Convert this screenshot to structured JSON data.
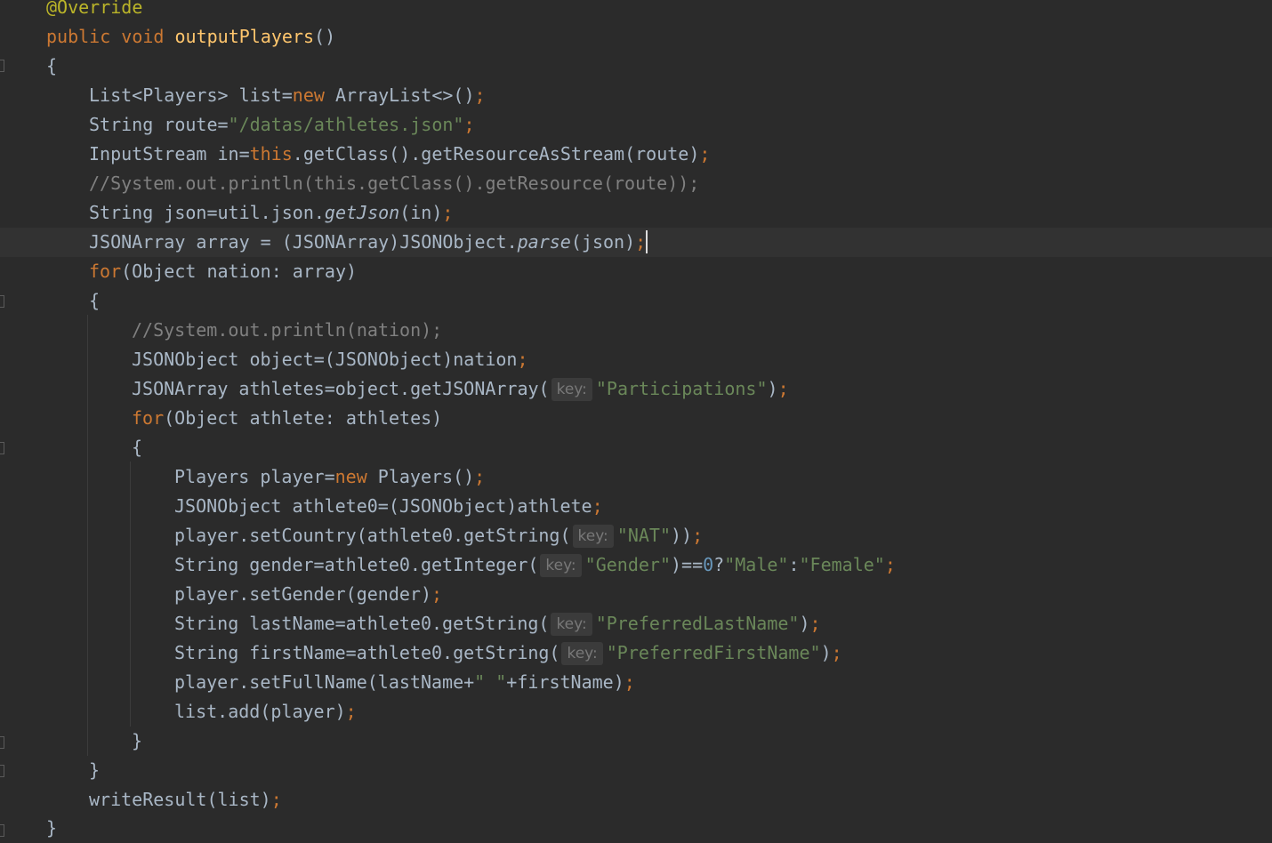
{
  "editor": {
    "lines": {
      "l01": {
        "ann": "@Override"
      },
      "l02": {
        "kw1": "public",
        "kw2": "void",
        "fn": "outputPlayers",
        "rest": "()"
      },
      "l03": {
        "text": "{"
      },
      "l04": {
        "a": "List<Players> list=",
        "kw": "new",
        "b": " ArrayList<>()",
        "semi": ";"
      },
      "l05": {
        "a": "String route=",
        "str": "\"/datas/athletes.json\"",
        "semi": ";"
      },
      "l06": {
        "a": "InputStream in=",
        "kw": "this",
        "b": ".getClass().getResourceAsStream(route)",
        "semi": ";"
      },
      "l07": {
        "cmt": "//System.out.println(this.getClass().getResource(route));"
      },
      "l08": {
        "a": "String json=util.json.",
        "it": "getJson",
        "b": "(in)",
        "semi": ";"
      },
      "l09": {
        "a": "JSONArray array = (JSONArray)JSONObject.",
        "it": "parse",
        "b": "(json)",
        "semi": ";"
      },
      "l10": {
        "kw": "for",
        "b": "(Object nation: array)"
      },
      "l11": {
        "text": "{"
      },
      "l12": {
        "cmt": "//System.out.println(nation);"
      },
      "l13": {
        "a": "JSONObject object=(JSONObject)nation",
        "semi": ";"
      },
      "l14": {
        "a": "JSONArray athletes=object.getJSONArray(",
        "hint": "key:",
        "str": "\"Participations\"",
        "b": ")",
        "semi": ";"
      },
      "l15": {
        "kw": "for",
        "b": "(Object athlete: athletes)"
      },
      "l16": {
        "text": "{"
      },
      "l17": {
        "a": "Players player=",
        "kw": "new",
        "b": " Players()",
        "semi": ";"
      },
      "l18": {
        "a": "JSONObject athlete0=(JSONObject)athlete",
        "semi": ";"
      },
      "l19": {
        "a": "player.setCountry(athlete0.getString(",
        "hint": "key:",
        "str": "\"NAT\"",
        "b": "))",
        "semi": ";"
      },
      "l20": {
        "a": "String gender=athlete0.getInteger(",
        "hint": "key:",
        "str": "\"Gender\"",
        "b": ")==",
        "num": "0",
        "c": "?",
        "str2": "\"Male\"",
        "d": ":",
        "str3": "\"Female\"",
        "semi": ";"
      },
      "l21": {
        "a": "player.setGender(gender)",
        "semi": ";"
      },
      "l22": {
        "a": "String lastName=athlete0.getString(",
        "hint": "key:",
        "str": "\"PreferredLastName\"",
        "b": ")",
        "semi": ";"
      },
      "l23": {
        "a": "String firstName=athlete0.getString(",
        "hint": "key:",
        "str": "\"PreferredFirstName\"",
        "b": ")",
        "semi": ";"
      },
      "l24": {
        "a": "player.setFullName(lastName+",
        "str": "\" \"",
        "b": "+firstName)",
        "semi": ";"
      },
      "l25": {
        "a": "list.add(player)",
        "semi": ";"
      },
      "l26": {
        "text": "}"
      },
      "l27": {
        "text": "}"
      },
      "l28": {
        "a": "writeResult(list)",
        "semi": ";"
      },
      "l29": {
        "text": "}"
      }
    }
  },
  "colors": {
    "background": "#2b2b2b",
    "caret_line": "#323232",
    "text": "#a9b7c6",
    "keyword": "#cc7832",
    "method_decl": "#ffc66d",
    "string": "#6a8759",
    "comment": "#808080",
    "annotation": "#bbb529",
    "number": "#6897bb"
  }
}
